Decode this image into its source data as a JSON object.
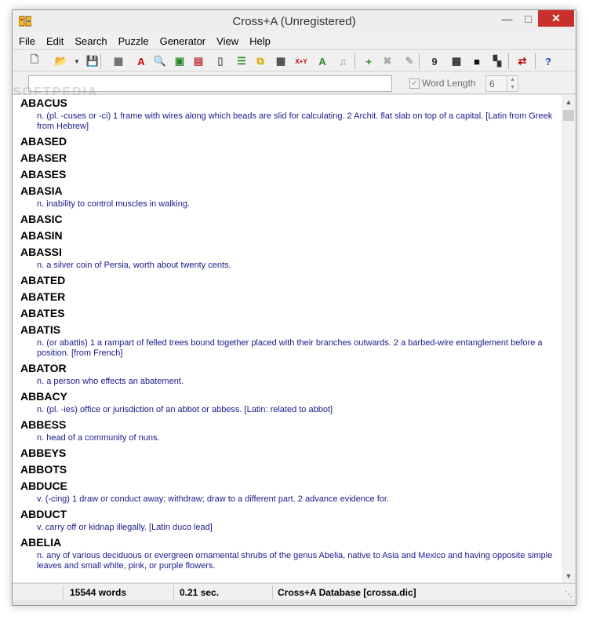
{
  "window": {
    "title": "Cross+A (Unregistered)"
  },
  "menu": [
    "File",
    "Edit",
    "Search",
    "Puzzle",
    "Generator",
    "View",
    "Help"
  ],
  "toolbar": {
    "buttons": [
      {
        "name": "new-icon",
        "glyph": "🗋",
        "color": "#666"
      },
      {
        "name": "open-icon",
        "glyph": "📂",
        "color": "#c79a00"
      },
      {
        "name": "save-icon",
        "glyph": "💾",
        "color": "#1f5fbf"
      },
      {
        "name": "grid-icon",
        "glyph": "▦",
        "color": "#666"
      },
      {
        "name": "font-icon",
        "glyph": "A",
        "color": "#d00000"
      },
      {
        "name": "find-icon",
        "glyph": "🔍",
        "color": "#2b6cc4"
      },
      {
        "name": "fill-icon",
        "glyph": "▣",
        "color": "#2a8a2a"
      },
      {
        "name": "fill-color-icon",
        "glyph": "▤",
        "color": "#c03030"
      },
      {
        "name": "clipboard-icon",
        "glyph": "▯",
        "color": "#666"
      },
      {
        "name": "rows-icon",
        "glyph": "☰",
        "color": "#2a8a2a"
      },
      {
        "name": "links-icon",
        "glyph": "⧉",
        "color": "#d9a400"
      },
      {
        "name": "matrix-icon",
        "glyph": "▦",
        "color": "#444"
      },
      {
        "name": "xy-icon",
        "glyph": "X+Y",
        "color": "#c00000"
      },
      {
        "name": "ab-icon",
        "glyph": "A",
        "color": "#2a8a2a"
      },
      {
        "name": "check-icon",
        "glyph": "♫",
        "color": "#999"
      },
      {
        "name": "add-icon",
        "glyph": "+",
        "color": "#2a8a2a"
      },
      {
        "name": "delete-icon",
        "glyph": "✖",
        "color": "#aaa"
      },
      {
        "name": "edit-icon",
        "glyph": "✎",
        "color": "#aaa"
      },
      {
        "name": "grid-9-icon",
        "glyph": "9",
        "color": "#333"
      },
      {
        "name": "grid-dense-icon",
        "glyph": "▦",
        "color": "#333"
      },
      {
        "name": "grid-black-icon",
        "glyph": "■",
        "color": "#111"
      },
      {
        "name": "grid-checker-icon",
        "glyph": "▚",
        "color": "#333"
      },
      {
        "name": "translate-icon",
        "glyph": "⇄",
        "color": "#c00000"
      },
      {
        "name": "help-icon",
        "glyph": "?",
        "color": "#1f4fa0"
      }
    ]
  },
  "search": {
    "value": "",
    "word_length_label": "Word Length",
    "word_length_value": "6",
    "watermark": "SOFTPEDIA"
  },
  "entries": [
    {
      "word": "ABACUS",
      "def": "n. (pl. -cuses or -ci) 1 frame with wires along which beads are slid for calculating. 2 Archit. flat slab on top of a capital. [Latin from Greek from Hebrew]"
    },
    {
      "word": "ABASED",
      "def": ""
    },
    {
      "word": "ABASER",
      "def": ""
    },
    {
      "word": "ABASES",
      "def": ""
    },
    {
      "word": "ABASIA",
      "def": "n. inability to control muscles in walking."
    },
    {
      "word": "ABASIC",
      "def": ""
    },
    {
      "word": "ABASIN",
      "def": ""
    },
    {
      "word": "ABASSI",
      "def": "n. a silver coin of Persia, worth about twenty cents."
    },
    {
      "word": "ABATED",
      "def": ""
    },
    {
      "word": "ABATER",
      "def": ""
    },
    {
      "word": "ABATES",
      "def": ""
    },
    {
      "word": "ABATIS",
      "def": "n. (or abattis) 1 a rampart of felled trees bound together placed with their branches outwards. 2 a barbed-wire entanglement before a position. [from French]"
    },
    {
      "word": "ABATOR",
      "def": "n. a person who effects an abatement."
    },
    {
      "word": "ABBACY",
      "def": "n. (pl. -ies) office or jurisdiction of an abbot or abbess. [Latin: related to abbot]"
    },
    {
      "word": "ABBESS",
      "def": "n. head of a community of nuns."
    },
    {
      "word": "ABBEYS",
      "def": ""
    },
    {
      "word": "ABBOTS",
      "def": ""
    },
    {
      "word": "ABDUCE",
      "def": "v. (-cing) 1 draw or conduct away; withdraw; draw to a different part. 2 advance evidence for."
    },
    {
      "word": "ABDUCT",
      "def": "v. carry off or kidnap illegally. [Latin duco lead]"
    },
    {
      "word": "ABELIA",
      "def": "n. any of various deciduous or evergreen ornamental shrubs of the genus Abelia, native to Asia and Mexico and having opposite simple leaves and small white, pink, or purple flowers."
    }
  ],
  "status": {
    "word_count": "15544 words",
    "time": "0.21 sec.",
    "database": "Cross+A Database [crossa.dic]"
  }
}
